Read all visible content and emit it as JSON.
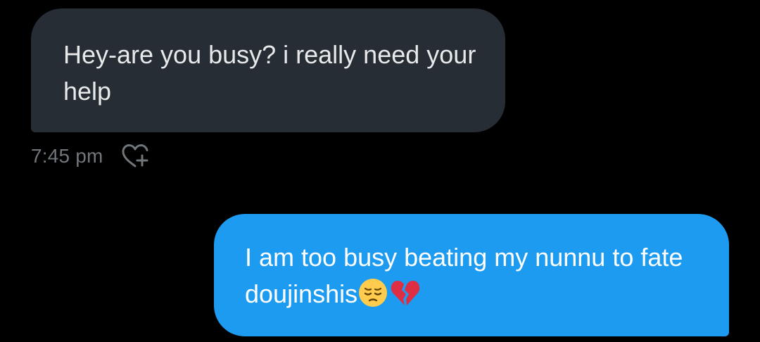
{
  "thread": {
    "messages": [
      {
        "direction": "received",
        "text": "Hey-are you busy? i really need your help",
        "timestamp": "7:45 pm",
        "reaction_icon": "heart-plus-icon"
      },
      {
        "direction": "sent",
        "text": "I am too busy beating my nunnu to fate doujinshis",
        "emojis": [
          "pensive-face-emoji",
          "broken-heart-emoji"
        ]
      }
    ]
  },
  "colors": {
    "background": "#000000",
    "received_bubble": "#262d34",
    "sent_bubble": "#1d9bf0",
    "timestamp_text": "#71767b"
  }
}
